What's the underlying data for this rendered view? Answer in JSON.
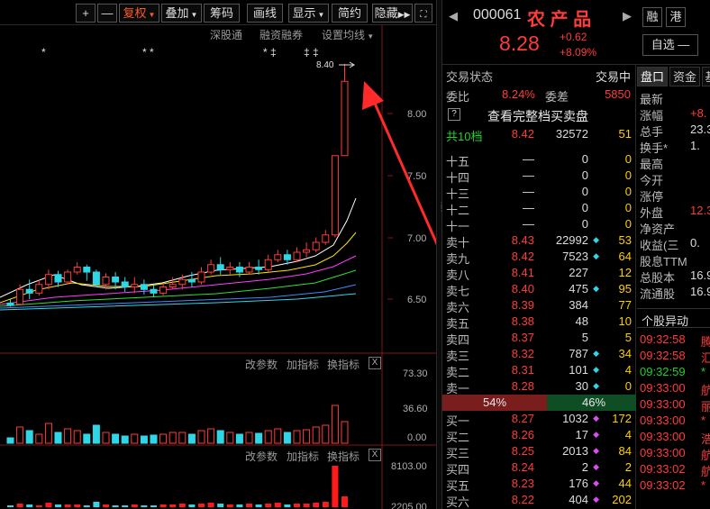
{
  "toolbar": {
    "plus": "+",
    "minus": "—",
    "fuquan": "复权",
    "diejia": "叠加",
    "chouma": "筹码",
    "huaxian": "画线",
    "xianshi": "显示",
    "jianyue": "简约",
    "yincang": "隐藏"
  },
  "chart_header": {
    "shengutong": "深股通",
    "rongzirongquan": "融资融券",
    "shezhi": "设置均线"
  },
  "chart_data": {
    "type": "candlestick",
    "y_ticks": [
      "8.00",
      "7.50",
      "7.00",
      "6.50"
    ],
    "high_annotation": "8.40",
    "event_markers": [
      "*",
      "* *",
      "* ‡",
      "‡ ‡"
    ],
    "volume_ticks": [
      "73.30",
      "36.60",
      "0.00"
    ],
    "third_ticks": [
      "8103.00",
      "2205.00"
    ]
  },
  "indicator1": {
    "gaicanshu": "改参数",
    "jiazhibiao": "加指标",
    "huanzhibiao": "换指标",
    "close": "X"
  },
  "indicator2": {
    "gaicanshu": "改参数",
    "jiazhibiao": "加指标",
    "huanzhibiao": "换指标",
    "close": "X"
  },
  "quote": {
    "code": "000061",
    "name": "农 产 品",
    "price": "8.28",
    "change": "+0.62",
    "change_pct": "+8.09%",
    "btn_rong": "融",
    "btn_gang": "港",
    "btn_zixuan": "自选 —",
    "arrow_left": "◀",
    "arrow_right": "▶"
  },
  "order_book": {
    "status_label": "交易状态",
    "status_value": "交易中",
    "weibi_label": "委比",
    "weibi_value": "8.24%",
    "weicha_label": "委差",
    "weicha_value": "5850",
    "view_full_icon": "?",
    "view_full": "查看完整档买卖盘",
    "levels_label": "共10档",
    "levels_price": "8.42",
    "levels_vol": "32572",
    "levels_cnt": "51",
    "empty_asks": [
      {
        "label": "十五",
        "price": "—",
        "vol": "0",
        "chg": "0"
      },
      {
        "label": "十四",
        "price": "—",
        "vol": "0",
        "chg": "0"
      },
      {
        "label": "十三",
        "price": "—",
        "vol": "0",
        "chg": "0"
      },
      {
        "label": "十二",
        "price": "—",
        "vol": "0",
        "chg": "0"
      },
      {
        "label": "十一",
        "price": "—",
        "vol": "0",
        "chg": "0"
      }
    ],
    "asks": [
      {
        "label": "卖十",
        "price": "8.43",
        "vol": "22992",
        "mark": "◆",
        "chg": "53"
      },
      {
        "label": "卖九",
        "price": "8.42",
        "vol": "7523",
        "mark": "◆",
        "chg": "64"
      },
      {
        "label": "卖八",
        "price": "8.41",
        "vol": "227",
        "mark": "",
        "chg": "12"
      },
      {
        "label": "卖七",
        "price": "8.40",
        "vol": "475",
        "mark": "◆",
        "chg": "95"
      },
      {
        "label": "卖六",
        "price": "8.39",
        "vol": "384",
        "mark": "",
        "chg": "77"
      },
      {
        "label": "卖五",
        "price": "8.38",
        "vol": "48",
        "mark": "",
        "chg": "10"
      },
      {
        "label": "卖四",
        "price": "8.37",
        "vol": "5",
        "mark": "",
        "chg": "5"
      },
      {
        "label": "卖三",
        "price": "8.32",
        "vol": "787",
        "mark": "◆",
        "chg": "34"
      },
      {
        "label": "卖二",
        "price": "8.31",
        "vol": "101",
        "mark": "◆",
        "chg": "4"
      },
      {
        "label": "卖一",
        "price": "8.28",
        "vol": "30",
        "mark": "◆",
        "chg": "0"
      }
    ],
    "ratio_sell": "54%",
    "ratio_buy": "46%",
    "bids": [
      {
        "label": "买一",
        "price": "8.27",
        "vol": "1032",
        "mark": "◆",
        "chg": "172"
      },
      {
        "label": "买二",
        "price": "8.26",
        "vol": "17",
        "mark": "◆",
        "chg": "4"
      },
      {
        "label": "买三",
        "price": "8.25",
        "vol": "2013",
        "mark": "◆",
        "chg": "84"
      },
      {
        "label": "买四",
        "price": "8.24",
        "vol": "2",
        "mark": "◆",
        "chg": "2"
      },
      {
        "label": "买五",
        "price": "8.23",
        "vol": "176",
        "mark": "◆",
        "chg": "44"
      },
      {
        "label": "买六",
        "price": "8.22",
        "vol": "404",
        "mark": "◆",
        "chg": "202"
      }
    ]
  },
  "side_panel": {
    "tab_pankou": "盘口",
    "tab_zijin": "资金",
    "tab_ji": "基",
    "stats": [
      {
        "label": "最新",
        "value": ""
      },
      {
        "label": "涨幅",
        "value": "+8."
      },
      {
        "label": "总手",
        "value": "23.3"
      },
      {
        "label": "换手*",
        "value": "1."
      },
      {
        "label": "最高",
        "value": ""
      },
      {
        "label": "今开",
        "value": ""
      },
      {
        "label": "涨停",
        "value": ""
      },
      {
        "label": "外盘",
        "value": "12.3"
      },
      {
        "label": "净资产",
        "value": ""
      },
      {
        "label": "收益(三",
        "value": "0."
      },
      {
        "label": "股息TTM",
        "value": ""
      },
      {
        "label": "总股本",
        "value": "16.9"
      },
      {
        "label": "流通股",
        "value": "16.9"
      }
    ],
    "yidong_title": "个股异动",
    "yidong": [
      {
        "time": "09:32:58",
        "ch": "腾",
        "c": "red"
      },
      {
        "time": "09:32:58",
        "ch": "汇",
        "c": "red"
      },
      {
        "time": "09:32:59",
        "ch": "*",
        "c": "green"
      },
      {
        "time": "09:33:00",
        "ch": "航",
        "c": "red"
      },
      {
        "time": "09:33:00",
        "ch": "丽",
        "c": "red"
      },
      {
        "time": "09:33:00",
        "ch": "*",
        "c": "red"
      },
      {
        "time": "09:33:00",
        "ch": "浩",
        "c": "red"
      },
      {
        "time": "09:33:00",
        "ch": "航",
        "c": "red"
      },
      {
        "time": "09:33:02",
        "ch": "航",
        "c": "red"
      },
      {
        "time": "09:33:02",
        "ch": "*",
        "c": "red"
      }
    ]
  }
}
